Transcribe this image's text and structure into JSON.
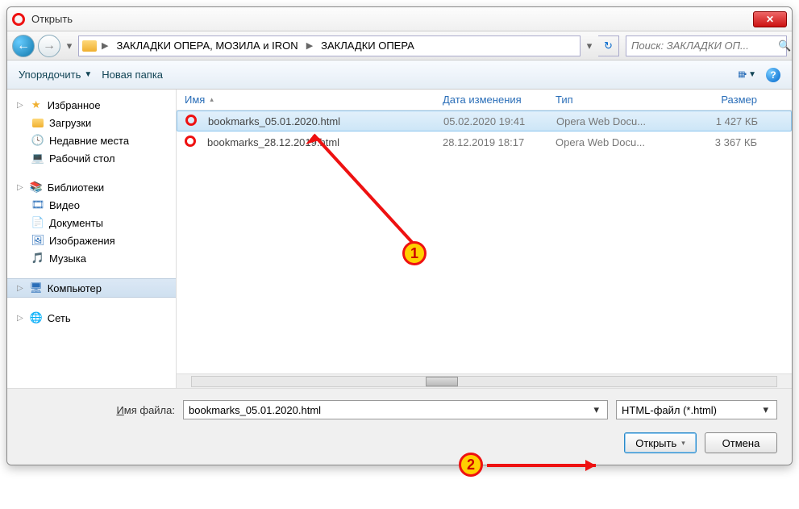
{
  "window": {
    "title": "Открыть"
  },
  "breadcrumb": {
    "seg1": "ЗАКЛАДКИ ОПЕРА,  МОЗИЛА и IRON",
    "seg2": "ЗАКЛАДКИ ОПЕРА"
  },
  "search": {
    "placeholder": "Поиск: ЗАКЛАДКИ ОП..."
  },
  "toolbar": {
    "organize": "Упорядочить",
    "newfolder": "Новая папка"
  },
  "sidebar": {
    "favorites": "Избранное",
    "downloads": "Загрузки",
    "recent": "Недавние места",
    "desktop": "Рабочий стол",
    "libraries": "Библиотеки",
    "videos": "Видео",
    "documents": "Документы",
    "pictures": "Изображения",
    "music": "Музыка",
    "computer": "Компьютер",
    "network": "Сеть"
  },
  "columns": {
    "name": "Имя",
    "date": "Дата изменения",
    "type": "Тип",
    "size": "Размер"
  },
  "files": [
    {
      "name": "bookmarks_05.01.2020.html",
      "date": "05.02.2020 19:41",
      "type": "Opera Web Docu...",
      "size": "1 427 КБ",
      "selected": true
    },
    {
      "name": "bookmarks_28.12.2019.html",
      "date": "28.12.2019 18:17",
      "type": "Opera Web Docu...",
      "size": "3 367 КБ",
      "selected": false
    }
  ],
  "footer": {
    "filename_label_pre": "И",
    "filename_label_post": "мя файла:",
    "filename_value": "bookmarks_05.01.2020.html",
    "filetype": "HTML-файл (*.html)",
    "open": "Открыть",
    "cancel": "Отмена"
  },
  "annotations": {
    "badge1": "1",
    "badge2": "2"
  }
}
